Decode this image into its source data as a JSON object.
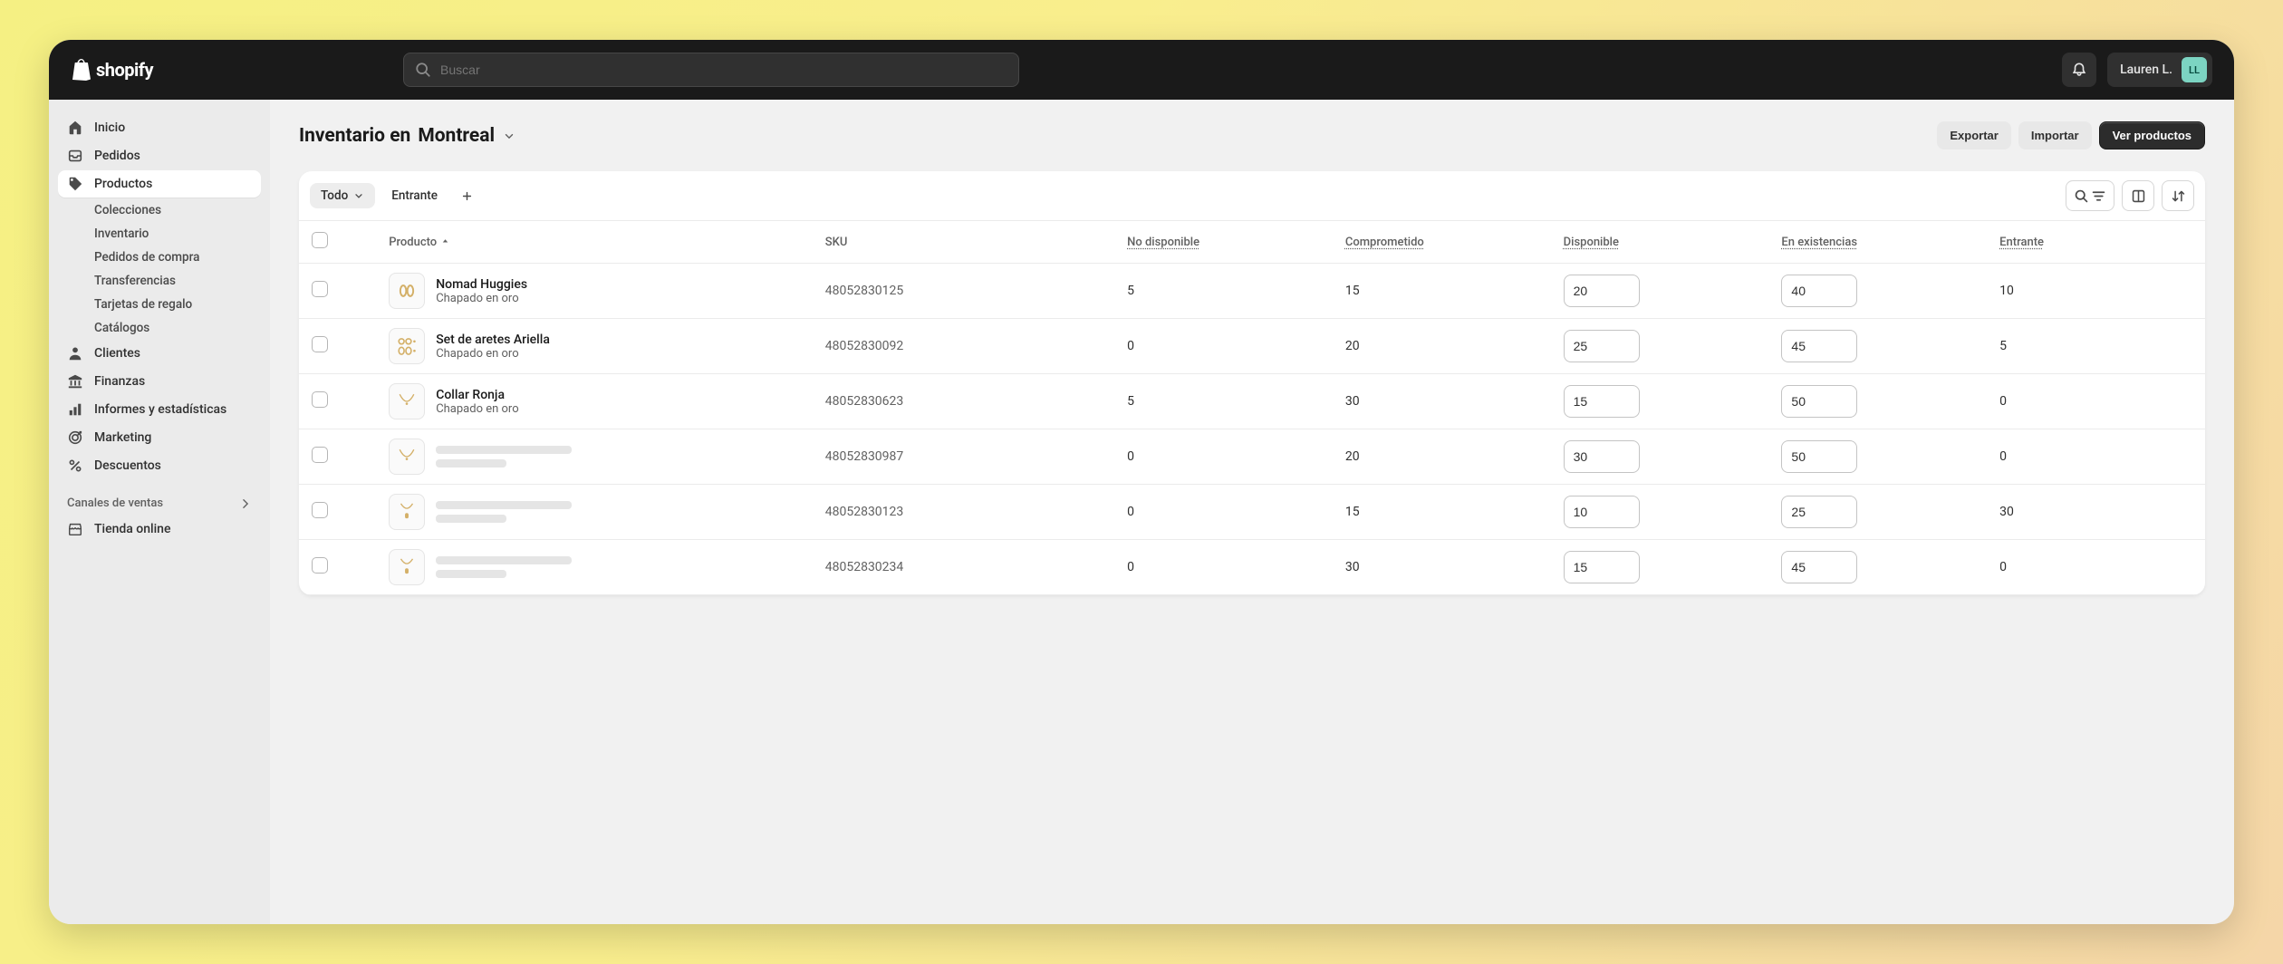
{
  "topbar": {
    "brand": "shopify",
    "search_placeholder": "Buscar",
    "user_name": "Lauren L.",
    "user_initials": "LL"
  },
  "sidebar": {
    "items": [
      {
        "id": "home",
        "label": "Inicio",
        "icon": "home"
      },
      {
        "id": "orders",
        "label": "Pedidos",
        "icon": "inbox"
      },
      {
        "id": "products",
        "label": "Productos",
        "icon": "tag",
        "active": true
      },
      {
        "id": "customers",
        "label": "Clientes",
        "icon": "person"
      },
      {
        "id": "finances",
        "label": "Finanzas",
        "icon": "bank"
      },
      {
        "id": "analytics",
        "label": "Informes y estadísticas",
        "icon": "bars"
      },
      {
        "id": "marketing",
        "label": "Marketing",
        "icon": "target"
      },
      {
        "id": "discounts",
        "label": "Descuentos",
        "icon": "percent"
      }
    ],
    "products_sub": [
      {
        "id": "collections",
        "label": "Colecciones"
      },
      {
        "id": "inventory",
        "label": "Inventario"
      },
      {
        "id": "purchase-orders",
        "label": "Pedidos de compra"
      },
      {
        "id": "transfers",
        "label": "Transferencias"
      },
      {
        "id": "gift-cards",
        "label": "Tarjetas de regalo"
      },
      {
        "id": "catalogs",
        "label": "Catálogos"
      }
    ],
    "channels_label": "Canales de ventas",
    "channels": [
      {
        "id": "online-store",
        "label": "Tienda online",
        "icon": "store"
      }
    ]
  },
  "page": {
    "title_prefix": "Inventario en",
    "location": "Montreal",
    "actions": {
      "export": "Exportar",
      "import": "Importar",
      "view_products": "Ver productos"
    }
  },
  "table": {
    "tabs": {
      "all": "Todo",
      "incoming": "Entrante"
    },
    "columns": {
      "product": "Producto",
      "sku": "SKU",
      "unavailable": "No disponible",
      "committed": "Comprometido",
      "available": "Disponible",
      "on_hand": "En existencias",
      "incoming": "Entrante"
    },
    "rows": [
      {
        "name": "Nomad Huggies",
        "variant": "Chapado en oro",
        "thumb": "huggies",
        "sku": "48052830125",
        "unavailable": "5",
        "committed": "15",
        "available": "20",
        "on_hand": "40",
        "incoming": "10"
      },
      {
        "name": "Set de aretes Ariella",
        "variant": "Chapado en oro",
        "thumb": "earring-set",
        "sku": "48052830092",
        "unavailable": "0",
        "committed": "20",
        "available": "25",
        "on_hand": "45",
        "incoming": "5"
      },
      {
        "name": "Collar Ronja",
        "variant": "Chapado en oro",
        "thumb": "necklace",
        "sku": "48052830623",
        "unavailable": "5",
        "committed": "30",
        "available": "15",
        "on_hand": "50",
        "incoming": "0"
      },
      {
        "name": "",
        "variant": "",
        "thumb": "necklace",
        "skeleton": true,
        "sku": "48052830987",
        "unavailable": "0",
        "committed": "20",
        "available": "30",
        "on_hand": "50",
        "incoming": "0"
      },
      {
        "name": "",
        "variant": "",
        "thumb": "pendant",
        "skeleton": true,
        "sku": "48052830123",
        "unavailable": "0",
        "committed": "15",
        "available": "10",
        "on_hand": "25",
        "incoming": "30"
      },
      {
        "name": "",
        "variant": "",
        "thumb": "pendant",
        "skeleton": true,
        "sku": "48052830234",
        "unavailable": "0",
        "committed": "30",
        "available": "15",
        "on_hand": "45",
        "incoming": "0"
      }
    ]
  }
}
